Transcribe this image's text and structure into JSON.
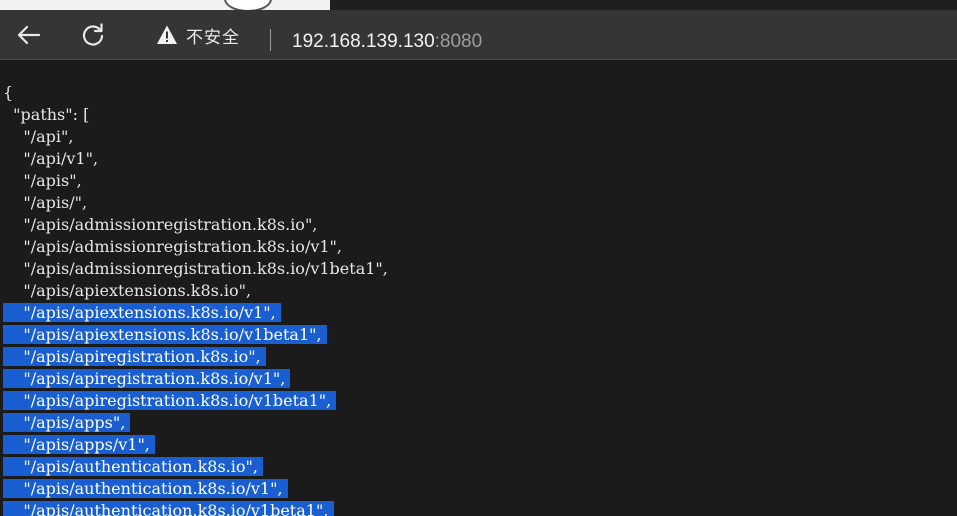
{
  "toolbar": {
    "security_label": "不安全",
    "url_host": "192.168.139.130",
    "url_port": ":8080"
  },
  "json": {
    "open_brace": "{",
    "paths_key": "\"paths\": [",
    "items": [
      "\"/api\",",
      "\"/api/v1\",",
      "\"/apis\",",
      "\"/apis/\",",
      "\"/apis/admissionregistration.k8s.io\",",
      "\"/apis/admissionregistration.k8s.io/v1\",",
      "\"/apis/admissionregistration.k8s.io/v1beta1\",",
      "\"/apis/apiextensions.k8s.io\",",
      "\"/apis/apiextensions.k8s.io/v1\",",
      "\"/apis/apiextensions.k8s.io/v1beta1\",",
      "\"/apis/apiregistration.k8s.io\",",
      "\"/apis/apiregistration.k8s.io/v1\",",
      "\"/apis/apiregistration.k8s.io/v1beta1\",",
      "\"/apis/apps\",",
      "\"/apis/apps/v1\",",
      "\"/apis/authentication.k8s.io\",",
      "\"/apis/authentication.k8s.io/v1\",",
      "\"/apis/authentication.k8s.io/v1beta1\","
    ]
  }
}
